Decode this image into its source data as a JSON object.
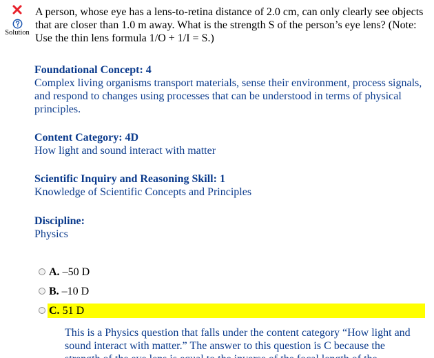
{
  "status": {
    "result_icon": "x-mark-icon",
    "result_color": "#e8202a",
    "solution_icon": "question-circle-icon",
    "solution_icon_color": "#1a55b0",
    "solution_label": "Solution"
  },
  "question": {
    "text": "A person, whose eye has a lens-to-retina distance of 2.0 cm, can only clearly see objects that are closer than 1.0 m away. What is the strength S of the person’s eye lens? (Note: Use the thin lens formula 1/O + 1/I = S.)"
  },
  "meta": {
    "foundational_concept": {
      "heading": "Foundational Concept: 4",
      "text": "Complex living organisms transport materials, sense their environment, process signals, and respond to changes using processes that can be understood in terms of physical principles."
    },
    "content_category": {
      "heading": "Content Category: 4D",
      "text": "How light and sound interact with matter"
    },
    "skill": {
      "heading": "Scientific Inquiry and Reasoning Skill: 1",
      "text": "Knowledge of Scientific Concepts and Principles"
    },
    "discipline": {
      "heading": "Discipline:",
      "text": "Physics"
    }
  },
  "choices": [
    {
      "letter": "A.",
      "value": "–50 D",
      "highlighted": false
    },
    {
      "letter": "B.",
      "value": "–10 D",
      "highlighted": false
    },
    {
      "letter": "C.",
      "value": "51 D",
      "highlighted": true
    }
  ],
  "highlight_color": "#ffff00",
  "accent_color": "#0a3a8c",
  "explanation": {
    "text": "This is a Physics question that falls under the content category “How light and sound interact with matter.” The answer to this question is C because the strength of the eye lens is equal to the inverse of the focal length of the"
  }
}
